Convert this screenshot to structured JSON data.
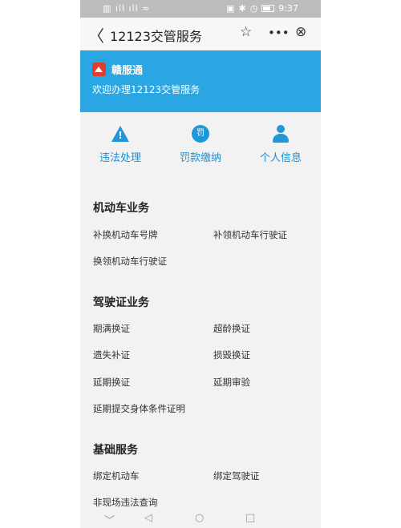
{
  "status_bar": {
    "left": "▥ ıll ıll ≈",
    "time": "9:37",
    "icons": [
      "nfc-icon",
      "bluetooth-icon",
      "alarm-icon",
      "battery-icon"
    ]
  },
  "nav": {
    "title": "12123交管服务",
    "back_icon": "back-icon",
    "star_icon": "star-icon",
    "more_icon": "more-icon",
    "close_icon": "close-icon"
  },
  "banner": {
    "brand": "赣服通",
    "welcome": "欢迎办理12123交管服务",
    "bg": "#2aa6e3"
  },
  "quick_actions": [
    {
      "label": "违法处理",
      "icon": "warning-icon"
    },
    {
      "label": "罚款缴纳",
      "icon": "fine-icon",
      "glyph": "罚"
    },
    {
      "label": "个人信息",
      "icon": "user-icon"
    }
  ],
  "sections": [
    {
      "title": "机动车业务",
      "items": [
        "补换机动车号牌",
        "补领机动车行驶证",
        "换领机动车行驶证"
      ]
    },
    {
      "title": "驾驶证业务",
      "items": [
        "期满换证",
        "超龄换证",
        "遗失补证",
        "损毁换证",
        "延期换证",
        "延期审验",
        "延期提交身体条件证明"
      ]
    },
    {
      "title": "基础服务",
      "items": [
        "绑定机动车",
        "绑定驾驶证",
        "非现场违法查询"
      ]
    }
  ],
  "system_nav": {
    "down": "﹀",
    "back": "◁",
    "home": "○",
    "recent": "□"
  },
  "accent": "#1d8fd6"
}
